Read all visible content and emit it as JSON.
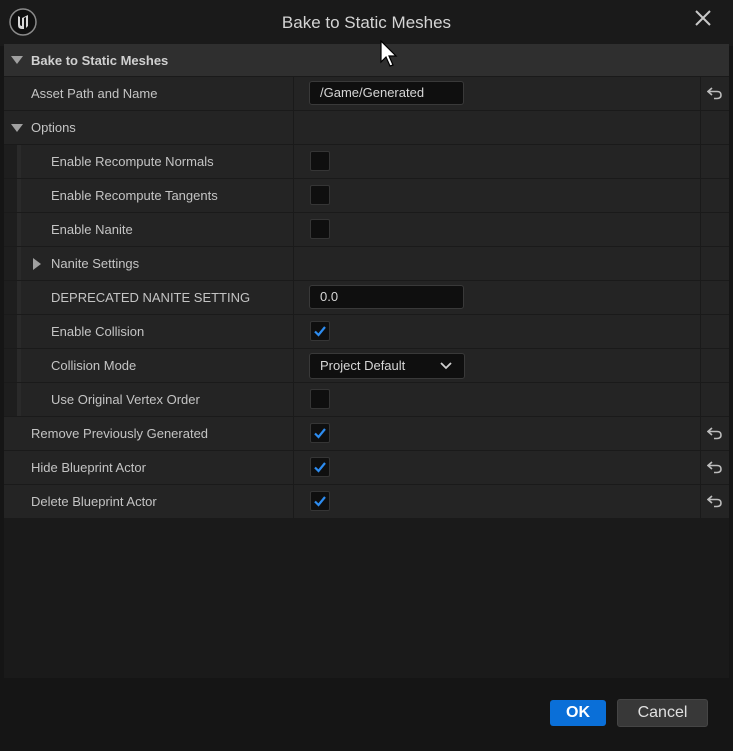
{
  "window": {
    "title": "Bake to Static Meshes",
    "logo_icon": "unreal-logo-icon",
    "close_icon": "close-icon"
  },
  "panel": {
    "category_label": "Bake to Static Meshes",
    "rows": {
      "asset_path": {
        "label": "Asset Path and Name",
        "value": "/Game/Generated"
      },
      "options": {
        "label": "Options"
      },
      "recompute_normals": {
        "label": "Enable Recompute Normals",
        "checked": false
      },
      "recompute_tangents": {
        "label": "Enable Recompute Tangents",
        "checked": false
      },
      "enable_nanite": {
        "label": "Enable Nanite",
        "checked": false
      },
      "nanite_settings": {
        "label": "Nanite Settings"
      },
      "deprecated_nanite": {
        "label": "DEPRECATED NANITE SETTING",
        "value": "0.0"
      },
      "enable_collision": {
        "label": "Enable Collision",
        "checked": true
      },
      "collision_mode": {
        "label": "Collision Mode",
        "value": "Project Default"
      },
      "original_vertex_order": {
        "label": "Use Original Vertex Order",
        "checked": false
      },
      "remove_previously_generated": {
        "label": "Remove Previously Generated",
        "checked": true
      },
      "hide_blueprint_actor": {
        "label": "Hide Blueprint Actor",
        "checked": true
      },
      "delete_blueprint_actor": {
        "label": "Delete Blueprint Actor",
        "checked": true
      }
    }
  },
  "footer": {
    "ok_label": "OK",
    "cancel_label": "Cancel"
  },
  "colors": {
    "accent": "#0a6fd8",
    "check": "#2d8cf0"
  }
}
